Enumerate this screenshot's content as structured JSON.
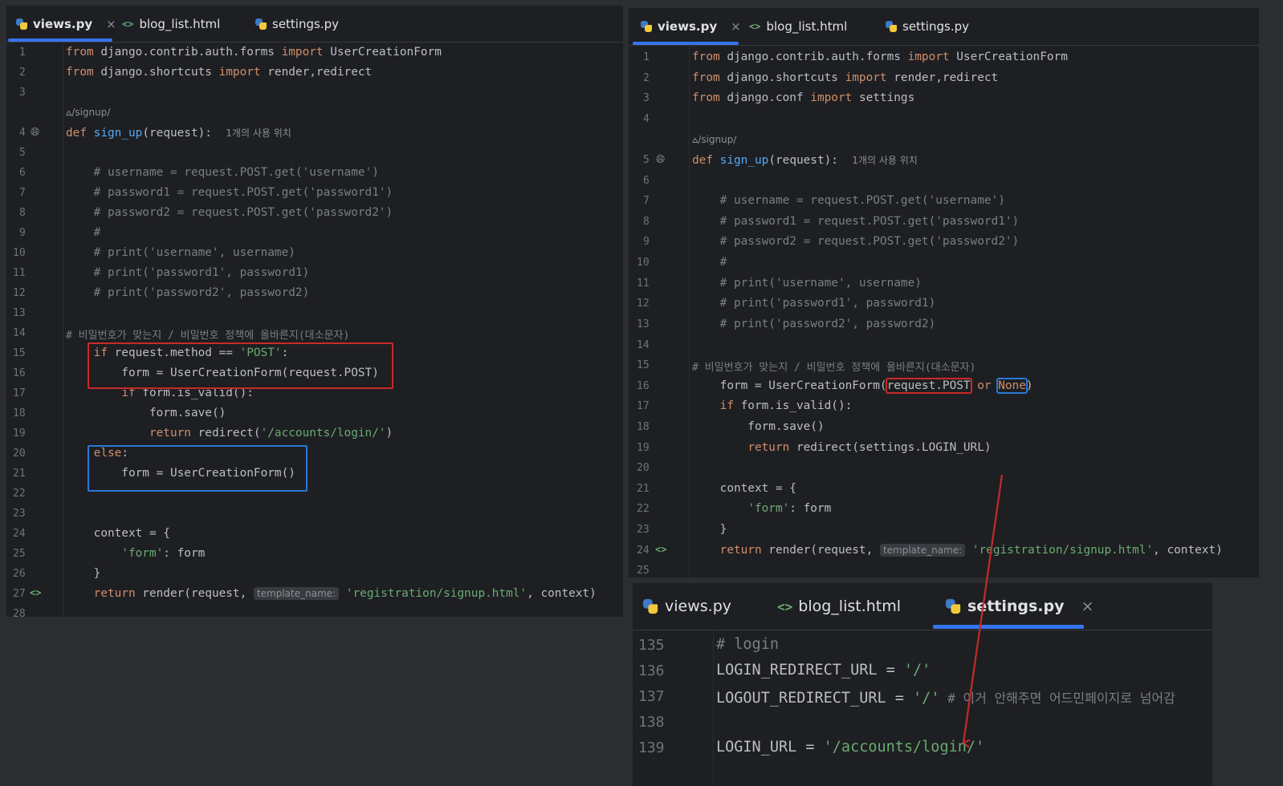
{
  "left_editor": {
    "tabs": [
      {
        "label": "views.py",
        "icon": "python-file-icon",
        "active": true,
        "closable": true
      },
      {
        "label": "blog_list.html",
        "icon": "html-file-icon",
        "active": false
      },
      {
        "label": "settings.py",
        "icon": "python-file-icon",
        "active": false
      }
    ],
    "line_numbers": [
      "1",
      "2",
      "3",
      "4",
      "5",
      "6",
      "7",
      "8",
      "9",
      "10",
      "11",
      "12",
      "13",
      "14",
      "15",
      "16",
      "17",
      "18",
      "19",
      "20",
      "21",
      "22",
      "23",
      "24",
      "25",
      "26",
      "27",
      "28"
    ],
    "endpoint_hint": "/signup/",
    "usage_hint": "1개의 사용 위치",
    "code": {
      "l1a": "from",
      "l1b": " django.contrib.auth.forms ",
      "l1c": "import",
      "l1d": " UserCreationForm",
      "l2a": "from",
      "l2b": " django.shortcuts ",
      "l2c": "import",
      "l2d": " render,redirect",
      "l4a": "def",
      "l4b": " ",
      "l4c": "sign_up",
      "l4d": "(request):",
      "l6": "    # username = request.POST.get('username')",
      "l7": "    # password1 = request.POST.get('password1')",
      "l8": "    # password2 = request.POST.get('password2')",
      "l9": "    #",
      "l10": "    # print('username', username)",
      "l11": "    # print('password1', password1)",
      "l12": "    # print('password2', password2)",
      "l14": "# 비밀번호가 맞는지 / 비밀번호 정책에 올바른지(대소문자)",
      "l15a": "    ",
      "l15b": "if",
      "l15c": " request.method == ",
      "l15d": "'POST'",
      "l15e": ":",
      "l16": "        form = UserCreationForm(request.POST)",
      "l17a": "        ",
      "l17b": "if",
      "l17c": " form.is_valid():",
      "l18": "            form.save()",
      "l19a": "            ",
      "l19b": "return",
      "l19c": " redirect(",
      "l19d": "'/accounts/login/'",
      "l19e": ")",
      "l20a": "    ",
      "l20b": "else",
      "l20c": ":",
      "l21": "        form = UserCreationForm()",
      "l24": "    context = {",
      "l25a": "        ",
      "l25b": "'form'",
      "l25c": ": form",
      "l26": "    }",
      "l27a": "    ",
      "l27b": "return",
      "l27c": " render(request, ",
      "l27d": "template_name:",
      "l27e": " ",
      "l27f": "'registration/signup.html'",
      "l27g": ", context)"
    }
  },
  "right_editor": {
    "tabs": [
      {
        "label": "views.py",
        "icon": "python-file-icon",
        "active": true,
        "closable": true
      },
      {
        "label": "blog_list.html",
        "icon": "html-file-icon",
        "active": false
      },
      {
        "label": "settings.py",
        "icon": "python-file-icon",
        "active": false
      }
    ],
    "line_numbers": [
      "1",
      "2",
      "3",
      "4",
      "5",
      "6",
      "7",
      "8",
      "9",
      "10",
      "11",
      "12",
      "13",
      "14",
      "15",
      "16",
      "17",
      "18",
      "19",
      "20",
      "21",
      "22",
      "23",
      "24",
      "25"
    ],
    "endpoint_hint": "/signup/",
    "usage_hint": "1개의 사용 위치",
    "code": {
      "l1a": "from",
      "l1b": " django.contrib.auth.forms ",
      "l1c": "import",
      "l1d": " UserCreationForm",
      "l2a": "from",
      "l2b": " django.shortcuts ",
      "l2c": "import",
      "l2d": " render,redirect",
      "l3a": "from",
      "l3b": " django.conf ",
      "l3c": "import",
      "l3d": " settings",
      "l5a": "def",
      "l5b": " ",
      "l5c": "sign_up",
      "l5d": "(request):",
      "l7": "    # username = request.POST.get('username')",
      "l8": "    # password1 = request.POST.get('password1')",
      "l9": "    # password2 = request.POST.get('password2')",
      "l10": "    #",
      "l11": "    # print('username', username)",
      "l12": "    # print('password1', password1)",
      "l13": "    # print('password2', password2)",
      "l15": "# 비밀번호가 맞는지 / 비밀번호 정책에 올바른지(대소문자)",
      "l16a": "    form = UserCreationForm(",
      "l16b": "request.POST",
      "l16c": " ",
      "l16d": "or",
      "l16e": " ",
      "l16f": "None",
      "l16g": ")",
      "l17a": "    ",
      "l17b": "if",
      "l17c": " form.is_valid():",
      "l18": "        form.save()",
      "l19a": "        ",
      "l19b": "return",
      "l19c": " redirect(settings.LOGIN_URL)",
      "l21": "    context = {",
      "l22a": "        ",
      "l22b": "'form'",
      "l22c": ": form",
      "l23": "    }",
      "l24a": "    ",
      "l24b": "return",
      "l24c": " render(request, ",
      "l24d": "template_name:",
      "l24e": " ",
      "l24f": "'registration/signup.html'",
      "l24g": ", context)"
    }
  },
  "settings_editor": {
    "tabs": [
      {
        "label": "views.py",
        "icon": "python-file-icon",
        "active": false
      },
      {
        "label": "blog_list.html",
        "icon": "html-file-icon",
        "active": false
      },
      {
        "label": "settings.py",
        "icon": "python-file-icon",
        "active": true,
        "closable": true
      }
    ],
    "line_numbers": [
      "135",
      "136",
      "137",
      "138",
      "139"
    ],
    "code": {
      "l135": "# login",
      "l136a": "LOGIN_REDIRECT_URL = ",
      "l136b": "'/'",
      "l137a": "LOGOUT_REDIRECT_URL = ",
      "l137b": "'/'",
      "l137c": " # 이거 안해주면 어드민페이지로 넘어감",
      "l139a": "LOGIN_URL = ",
      "l139b": "'/accounts/login/'"
    }
  },
  "gutter_icons": {
    "globe": "globe-icon",
    "tag": "html-tag-icon",
    "endpoint": "endpoint-icon"
  },
  "close_glyph": "×",
  "tag_glyph": "<>",
  "colors": {
    "keyword": "#cf8e6d",
    "function": "#56a8f5",
    "string": "#6aab73",
    "comment": "#7a7e85",
    "highlight_red": "#c82a2a",
    "highlight_blue": "#2a78d6",
    "arrow": "#c42b2b",
    "tab_underline": "#3574f0"
  }
}
